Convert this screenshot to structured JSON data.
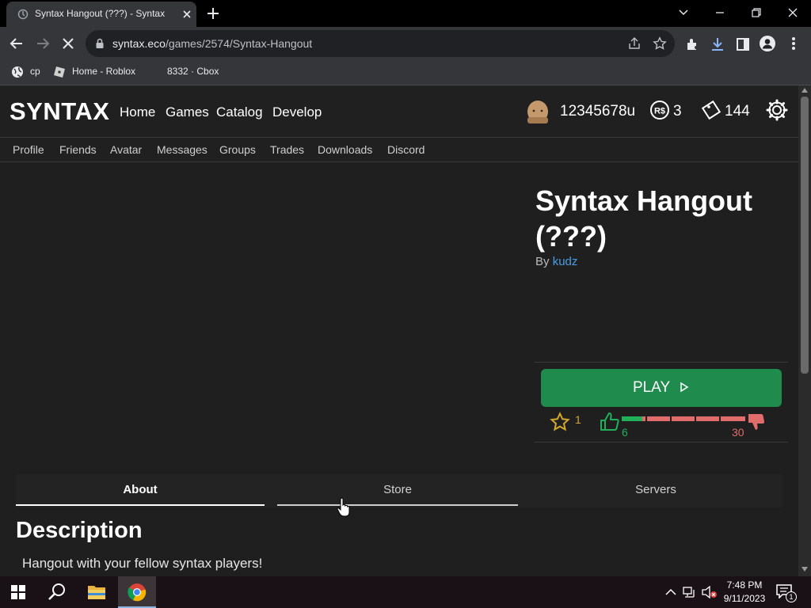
{
  "browser": {
    "tab_title": "Syntax Hangout (???) - Syntax",
    "url_host": "syntax.eco",
    "url_path": "/games/2574/Syntax-Hangout",
    "bookmarks": [
      "cp",
      "Home - Roblox",
      "8332 · Cbox"
    ]
  },
  "site": {
    "logo": "SYNTAX",
    "nav": [
      "Home",
      "Games",
      "Catalog",
      "Develop"
    ],
    "username": "12345678u",
    "robux": "3",
    "tickets": "144",
    "subnav": [
      "Profile",
      "Friends",
      "Avatar",
      "Messages",
      "Groups",
      "Trades",
      "Downloads",
      "Discord"
    ]
  },
  "game": {
    "title": "Syntax Hangout (???)",
    "by_label": "By",
    "author": "kudz",
    "play_label": "PLAY",
    "favorites": "1",
    "upvotes": "6",
    "downvotes": "30",
    "tabs": [
      "About",
      "Store",
      "Servers"
    ],
    "active_tab": "About",
    "description_heading": "Description",
    "description": "Hangout with your fellow syntax players!"
  },
  "taskbar": {
    "time": "7:48 PM",
    "date": "9/11/2023",
    "notifications": "1"
  },
  "colors": {
    "play": "#1f8b4c",
    "upvote": "#21b05a",
    "downvote": "#e06c6c",
    "link": "#4a9de6",
    "favorite": "#d4a72c"
  }
}
